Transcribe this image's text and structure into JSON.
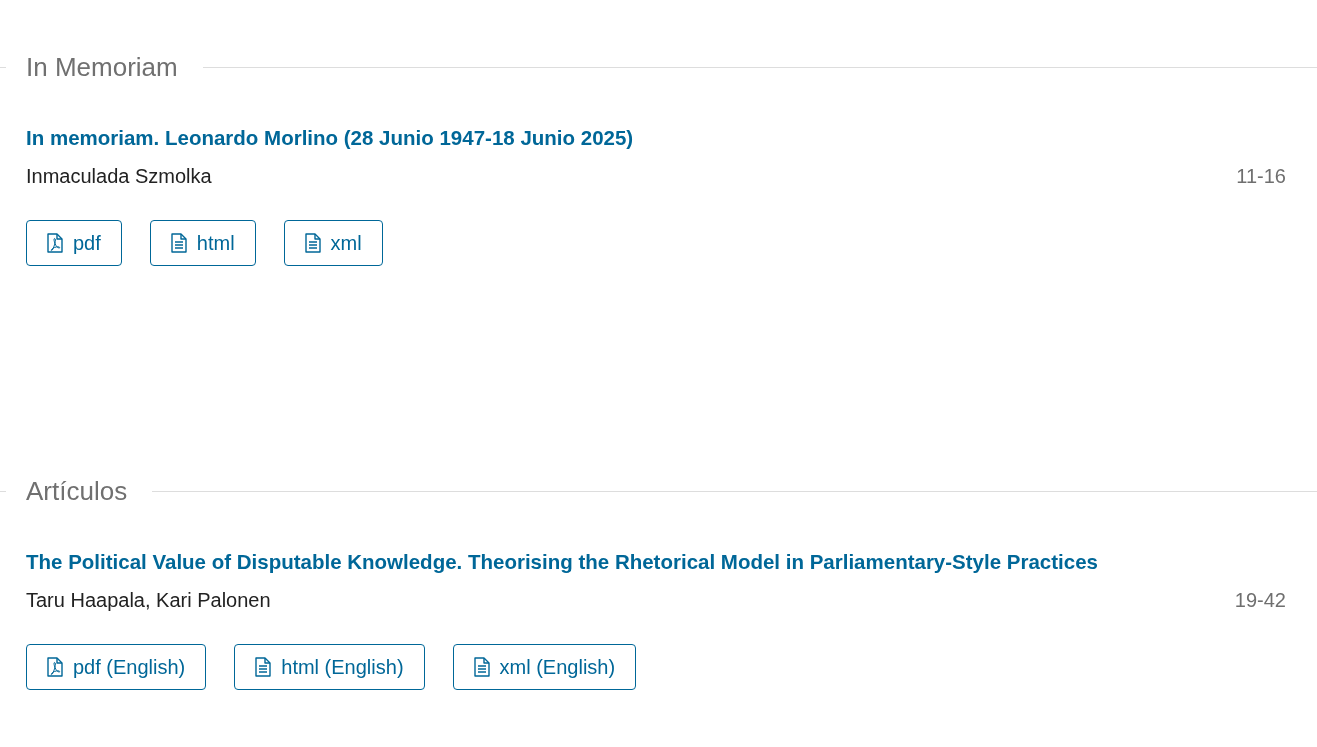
{
  "sections": [
    {
      "heading": "In Memoriam",
      "articles": [
        {
          "title": "In memoriam. Leonardo Morlino (28 Junio 1947-18 Junio 2025)",
          "authors": "Inmaculada Szmolka",
          "pages": "11-16",
          "galleys": [
            {
              "kind": "pdf",
              "label": "pdf"
            },
            {
              "kind": "document",
              "label": "html"
            },
            {
              "kind": "document",
              "label": "xml"
            }
          ]
        }
      ]
    },
    {
      "heading": "Artículos",
      "articles": [
        {
          "title": "The Political Value of Disputable Knowledge. Theorising the Rhetorical Model in Parliamentary-Style Practices",
          "authors": "Taru Haapala, Kari Palonen",
          "pages": "19-42",
          "galleys": [
            {
              "kind": "pdf",
              "label": "pdf (English)"
            },
            {
              "kind": "document",
              "label": "html (English)"
            },
            {
              "kind": "document",
              "label": "xml (English)"
            }
          ]
        }
      ]
    }
  ]
}
